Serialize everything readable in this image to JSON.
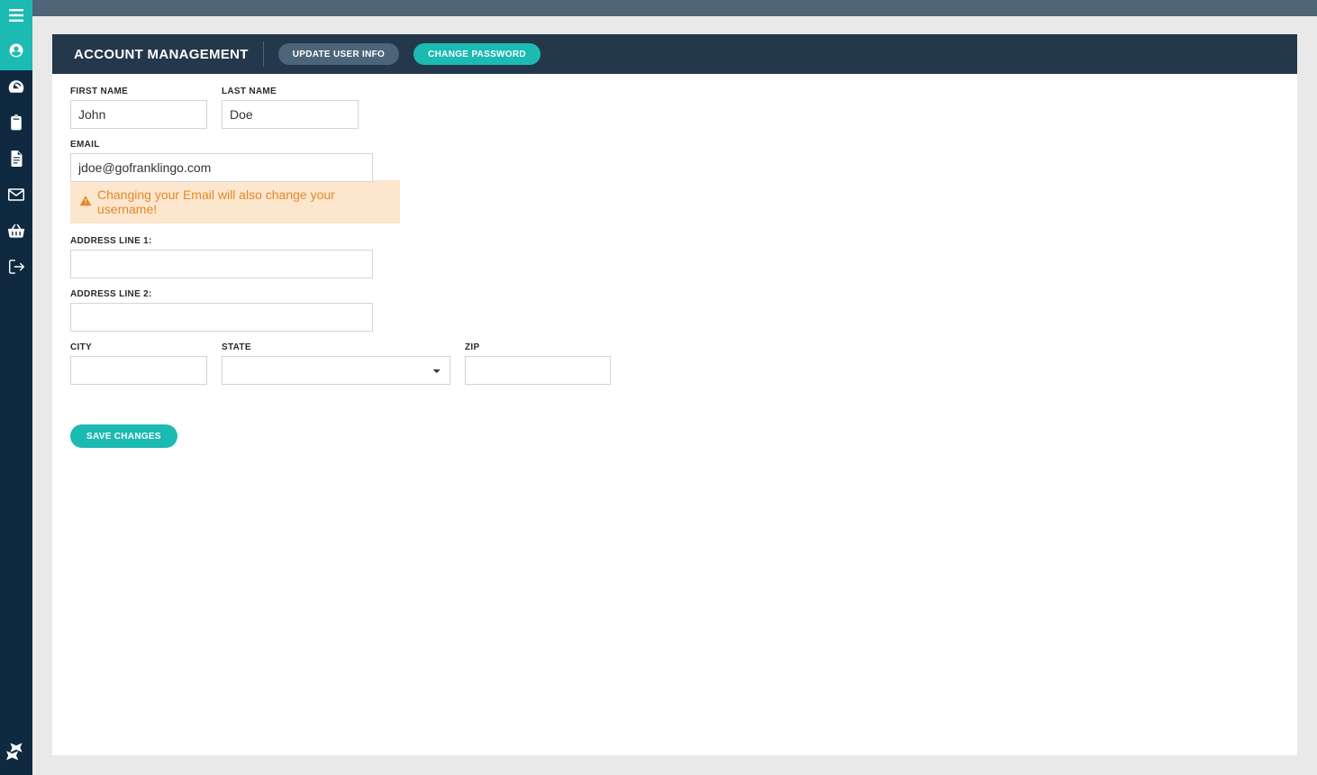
{
  "sidebar": {
    "items": [
      {
        "id": "account",
        "icon": "user-circle-icon",
        "active": true
      },
      {
        "id": "dashboard",
        "icon": "gauge-icon",
        "active": false
      },
      {
        "id": "clipboard",
        "icon": "clipboard-icon",
        "active": false
      },
      {
        "id": "document",
        "icon": "file-icon",
        "active": false
      },
      {
        "id": "messages",
        "icon": "envelope-icon",
        "active": false
      },
      {
        "id": "cart",
        "icon": "basket-icon",
        "active": false
      },
      {
        "id": "logout",
        "icon": "sign-out-icon",
        "active": false
      }
    ]
  },
  "header": {
    "title": "ACCOUNT MANAGEMENT",
    "tab_update_label": "UPDATE USER INFO",
    "tab_password_label": "CHANGE PASSWORD"
  },
  "form": {
    "first_name_label": "FIRST NAME",
    "first_name_value": "John",
    "last_name_label": "LAST NAME",
    "last_name_value": "Doe",
    "email_label": "EMAIL",
    "email_value": "jdoe@gofranklingo.com",
    "email_warning": "Changing your Email will also change your username!",
    "address1_label": "ADDRESS LINE 1:",
    "address1_value": "",
    "address2_label": "ADDRESS LINE 2:",
    "address2_value": "",
    "city_label": "CITY",
    "city_value": "",
    "state_label": "STATE",
    "state_value": "",
    "zip_label": "ZIP",
    "zip_value": "",
    "save_label": "SAVE CHANGES"
  }
}
